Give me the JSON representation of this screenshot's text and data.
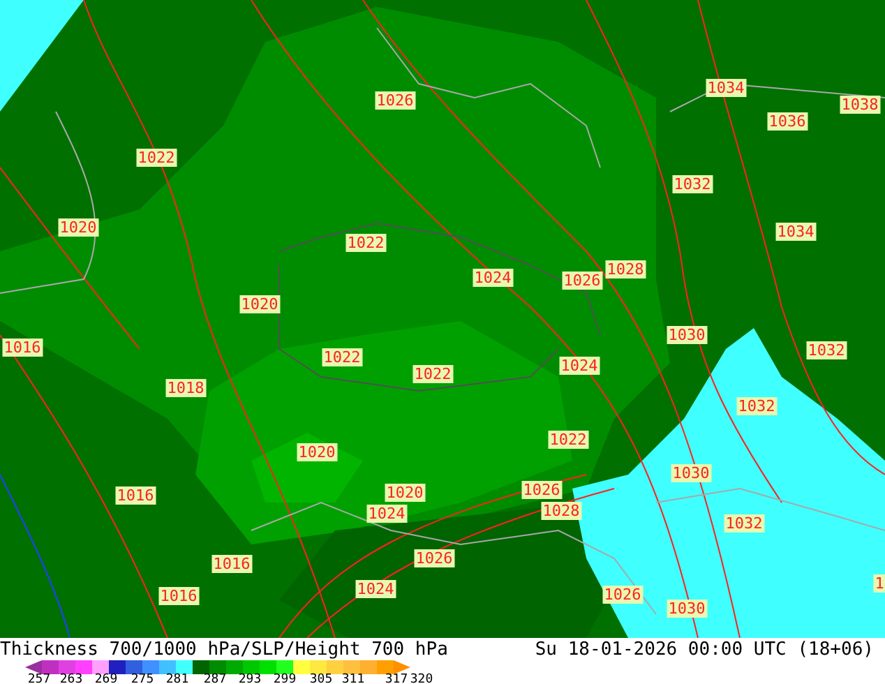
{
  "map": {
    "isobar_labels": [
      {
        "text": "1026"
      },
      {
        "text": "1034"
      },
      {
        "text": "1038"
      },
      {
        "text": "1036"
      },
      {
        "text": "1022"
      },
      {
        "text": "1032"
      },
      {
        "text": "1020"
      },
      {
        "text": "1034"
      },
      {
        "text": "1022"
      },
      {
        "text": "1024"
      },
      {
        "text": "1026"
      },
      {
        "text": "1028"
      },
      {
        "text": "1020"
      },
      {
        "text": "1030"
      },
      {
        "text": "1016"
      },
      {
        "text": "1032"
      },
      {
        "text": "1022"
      },
      {
        "text": "1022"
      },
      {
        "text": "1024"
      },
      {
        "text": "1018"
      },
      {
        "text": "1032"
      },
      {
        "text": "1022"
      },
      {
        "text": "1020"
      },
      {
        "text": "1030"
      },
      {
        "text": "1016"
      },
      {
        "text": "1020"
      },
      {
        "text": "1026"
      },
      {
        "text": "1028"
      },
      {
        "text": "1024"
      },
      {
        "text": "1032"
      },
      {
        "text": "1026"
      },
      {
        "text": "1016"
      },
      {
        "text": "1024"
      },
      {
        "text": "1016"
      },
      {
        "text": "1026"
      },
      {
        "text": "1030"
      },
      {
        "text": "1"
      }
    ]
  },
  "title": "Thickness 700/1000 hPa/SLP/Height 700 hPa",
  "valid_time": "Su 18-01-2026 00:00 UTC (18+06)",
  "legend": {
    "swatches": [
      {
        "color": "#9a2fa0"
      },
      {
        "color": "#c030c0"
      },
      {
        "color": "#e040e0"
      },
      {
        "color": "#ff40ff"
      },
      {
        "color": "#ffa0ff"
      },
      {
        "color": "#2020c0"
      },
      {
        "color": "#3060e0"
      },
      {
        "color": "#4090ff"
      },
      {
        "color": "#40c0ff"
      },
      {
        "color": "#40ffff"
      },
      {
        "color": "#006400"
      },
      {
        "color": "#008c00"
      },
      {
        "color": "#00aa00"
      },
      {
        "color": "#00c800"
      },
      {
        "color": "#00e000"
      },
      {
        "color": "#20ff20"
      },
      {
        "color": "#ffff40"
      },
      {
        "color": "#ffe840"
      },
      {
        "color": "#ffd040"
      },
      {
        "color": "#ffc040"
      },
      {
        "color": "#ffb030"
      },
      {
        "color": "#ffa000"
      },
      {
        "color": "#ff9000"
      }
    ],
    "ticks": [
      "257",
      "263",
      "269",
      "275",
      "281",
      "287",
      "293",
      "299",
      "305",
      "311",
      "317",
      "320"
    ]
  }
}
